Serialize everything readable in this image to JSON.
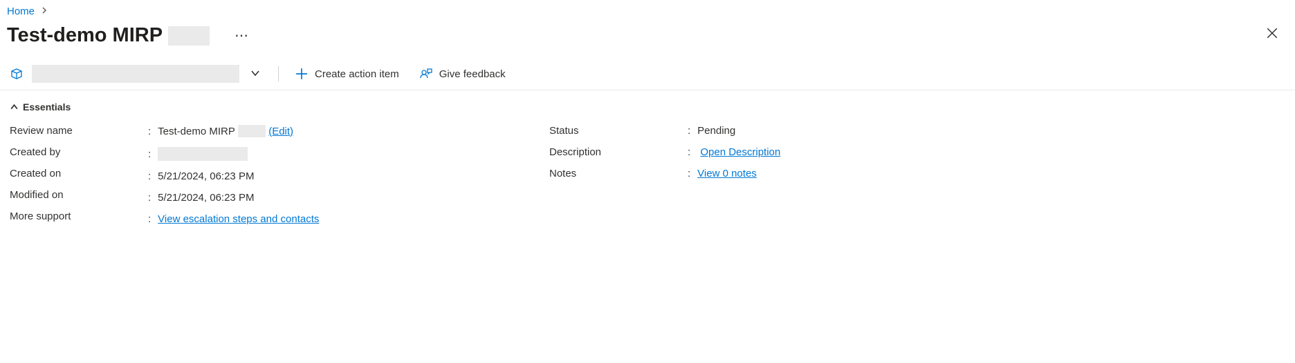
{
  "breadcrumb": {
    "home": "Home"
  },
  "title": "Test-demo MIRP",
  "toolbar": {
    "create_label": "Create action item",
    "feedback_label": "Give feedback"
  },
  "section": {
    "essentials": "Essentials"
  },
  "left": {
    "review_name_label": "Review name",
    "review_name_value": "Test-demo MIRP",
    "edit_label": "(Edit)",
    "created_by_label": "Created by",
    "created_on_label": "Created on",
    "created_on_value": "5/21/2024, 06:23 PM",
    "modified_on_label": "Modified on",
    "modified_on_value": "5/21/2024, 06:23 PM",
    "more_support_label": "More support",
    "more_support_link": "View escalation steps and contacts"
  },
  "right": {
    "status_label": "Status",
    "status_value": "Pending",
    "description_label": "Description",
    "description_link": "Open Description",
    "notes_label": "Notes",
    "notes_link": "View 0 notes"
  }
}
